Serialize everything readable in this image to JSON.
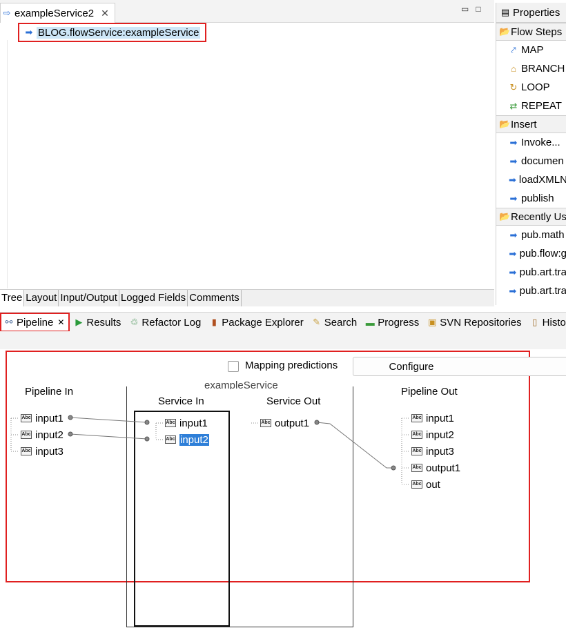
{
  "editor": {
    "tab_title": "exampleService2",
    "flow_step": "BLOG.flowService:exampleService"
  },
  "bottom_tabs": [
    "Tree",
    "Layout",
    "Input/Output",
    "Logged Fields",
    "Comments"
  ],
  "palette": {
    "title": "Properties",
    "groups": [
      {
        "name": "Flow Steps",
        "items": [
          "MAP",
          "BRANCH",
          "LOOP",
          "REPEAT"
        ]
      },
      {
        "name": "Insert",
        "items": [
          "Invoke...",
          "documen",
          "loadXMLN",
          "publish"
        ]
      },
      {
        "name": "Recently Us",
        "items": [
          "pub.math",
          "pub.flow:g",
          "pub.art.tra",
          "pub.art.tra"
        ]
      }
    ]
  },
  "view_tabs": [
    "Pipeline",
    "Results",
    "Refactor Log",
    "Package Explorer",
    "Search",
    "Progress",
    "SVN Repositories",
    "History"
  ],
  "pipeline": {
    "mapping_predictions_label": "Mapping predictions",
    "configure_label": "Configure",
    "service_name": "exampleService",
    "pipeline_in": {
      "title": "Pipeline In",
      "fields": [
        "input1",
        "input2",
        "input3"
      ]
    },
    "service_in": {
      "title": "Service In",
      "fields": [
        "input1",
        "input2"
      ]
    },
    "service_out": {
      "title": "Service Out",
      "fields": [
        "output1"
      ]
    },
    "pipeline_out": {
      "title": "Pipeline Out",
      "fields": [
        "input1",
        "input2",
        "input3",
        "output1",
        "out"
      ]
    },
    "abc_label": "Abc"
  },
  "colors": {
    "highlight": "#e02020",
    "selection": "#2e7fd8"
  }
}
